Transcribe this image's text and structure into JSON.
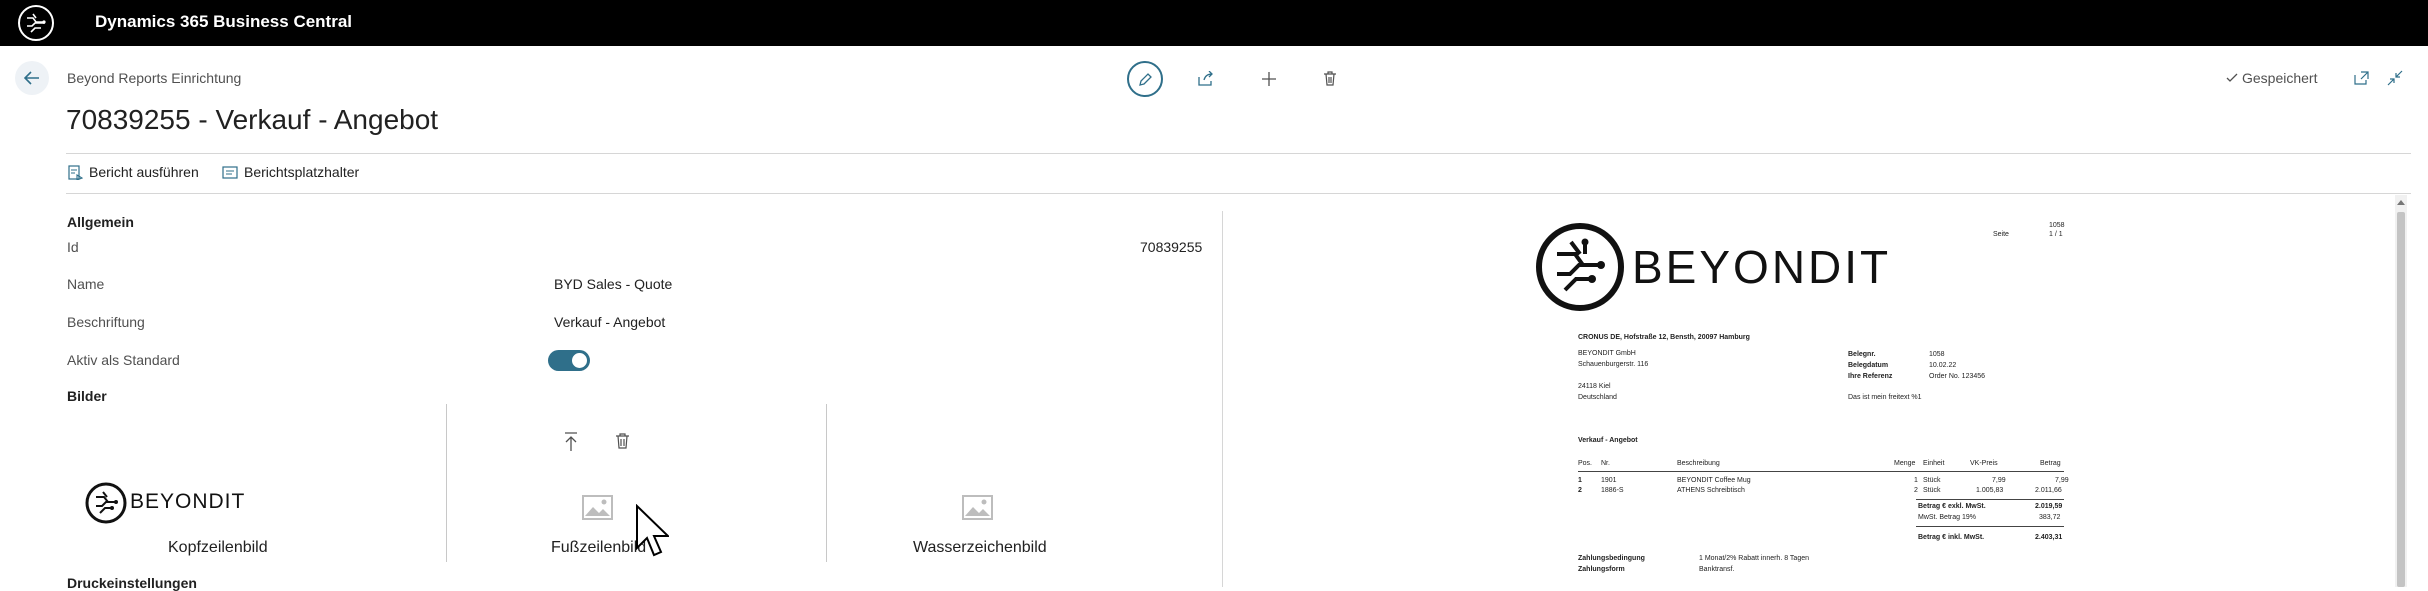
{
  "app": {
    "title": "Dynamics 365 Business Central"
  },
  "header": {
    "breadcrumb": "Beyond Reports Einrichtung",
    "title": "70839255 - Verkauf - Angebot",
    "saved_label": "Gespeichert"
  },
  "actions": [
    {
      "label": "Bericht ausführen",
      "icon": "report-run-icon"
    },
    {
      "label": "Berichtsplatzhalter",
      "icon": "placeholder-icon"
    }
  ],
  "general": {
    "caption": "Allgemein",
    "fields": [
      {
        "label": "Id",
        "value": "70839255"
      },
      {
        "label": "Name",
        "value": "BYD Sales - Quote"
      },
      {
        "label": "Beschriftung",
        "value": "Verkauf - Angebot"
      },
      {
        "label": "Aktiv als Standard",
        "value": ""
      }
    ],
    "toggle_on": true
  },
  "images": {
    "caption": "Bilder",
    "logo_text": "BEYONDIT",
    "slots": [
      {
        "caption": "Kopfzeilenbild"
      },
      {
        "caption": "Fußzeilenbild"
      },
      {
        "caption": "Wasserzeichenbild"
      }
    ]
  },
  "print": {
    "caption": "Druckeinstellungen"
  },
  "preview": {
    "logo_text": "BEYONDIT",
    "page_label": "Seite",
    "page_no": "1058",
    "page_count": "1 / 1",
    "sender_line": "CRONUS DE, Hofstraße 12, Bensth, 20097 Hamburg",
    "address": [
      "BEYONDIT GmbH",
      "Schauenburgerstr. 116",
      "",
      "24118 Kiel",
      "Deutschland"
    ],
    "meta": [
      {
        "label": "Belegnr.",
        "value": "1058"
      },
      {
        "label": "Belegdatum",
        "value": "10.02.22"
      },
      {
        "label": "Ihre Referenz",
        "value": "Order No. 123456"
      }
    ],
    "note": "Das ist mein freitext %1",
    "doc_title": "Verkauf - Angebot",
    "columns": [
      "Pos.",
      "Nr.",
      "Beschreibung",
      "Menge",
      "Einheit",
      "VK-Preis",
      "Betrag"
    ],
    "rows": [
      [
        "1",
        "1901",
        "BEYONDIT Coffee Mug",
        "1",
        "Stück",
        "7,99",
        "7,99"
      ],
      [
        "2",
        "1886-S",
        "ATHENS Schreibtisch",
        "2",
        "Stück",
        "1.005,83",
        "2.011,66"
      ]
    ],
    "totals": [
      {
        "label": "Betrag € exkl. MwSt.",
        "value": "2.019,59"
      },
      {
        "label": "MwSt. Betrag 19%",
        "value": "383,72"
      },
      {
        "label": "Betrag € inkl. MwSt.",
        "value": "2.403,31"
      }
    ],
    "terms": [
      {
        "label": "Zahlungsbedingung",
        "value": "1 Monat/2% Rabatt innerh. 8 Tagen"
      },
      {
        "label": "Zahlungsform",
        "value": "Banktransf."
      }
    ]
  },
  "colors": {
    "topbar": "#000000",
    "accent": "#2f6f8a"
  }
}
